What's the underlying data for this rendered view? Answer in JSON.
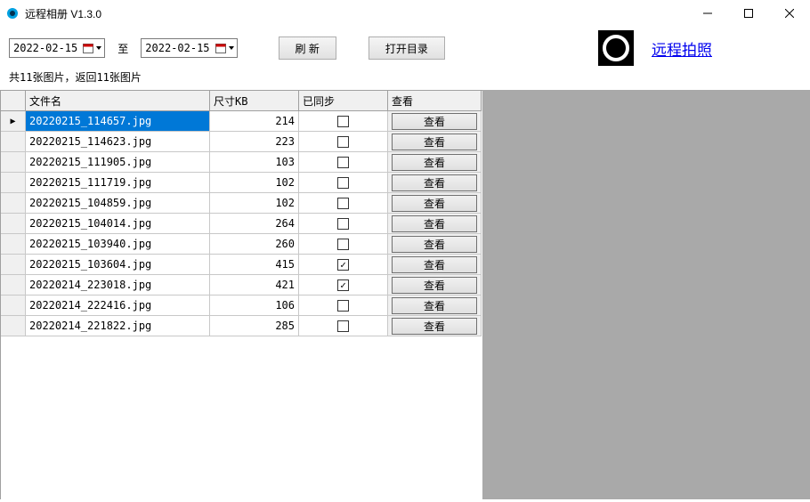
{
  "window": {
    "title": "远程相册 V1.3.0"
  },
  "toolbar": {
    "date_from": "2022-02-15",
    "to_label": "至",
    "date_to": "2022-02-15",
    "refresh_label": "刷 新",
    "open_dir_label": "打开目录",
    "remote_shoot_label": "远程拍照"
  },
  "status": {
    "text": "共11张图片，返回11张图片"
  },
  "grid": {
    "headers": {
      "filename": "文件名",
      "size": "尺寸KB",
      "synced": "已同步",
      "view": "查看"
    },
    "view_button_label": "查看",
    "rows": [
      {
        "filename": "20220215_114657.jpg",
        "size": "214",
        "synced": false,
        "selected": true
      },
      {
        "filename": "20220215_114623.jpg",
        "size": "223",
        "synced": false,
        "selected": false
      },
      {
        "filename": "20220215_111905.jpg",
        "size": "103",
        "synced": false,
        "selected": false
      },
      {
        "filename": "20220215_111719.jpg",
        "size": "102",
        "synced": false,
        "selected": false
      },
      {
        "filename": "20220215_104859.jpg",
        "size": "102",
        "synced": false,
        "selected": false
      },
      {
        "filename": "20220215_104014.jpg",
        "size": "264",
        "synced": false,
        "selected": false
      },
      {
        "filename": "20220215_103940.jpg",
        "size": "260",
        "synced": false,
        "selected": false
      },
      {
        "filename": "20220215_103604.jpg",
        "size": "415",
        "synced": true,
        "selected": false
      },
      {
        "filename": "20220214_223018.jpg",
        "size": "421",
        "synced": true,
        "selected": false
      },
      {
        "filename": "20220214_222416.jpg",
        "size": "106",
        "synced": false,
        "selected": false
      },
      {
        "filename": "20220214_221822.jpg",
        "size": "285",
        "synced": false,
        "selected": false
      }
    ]
  }
}
